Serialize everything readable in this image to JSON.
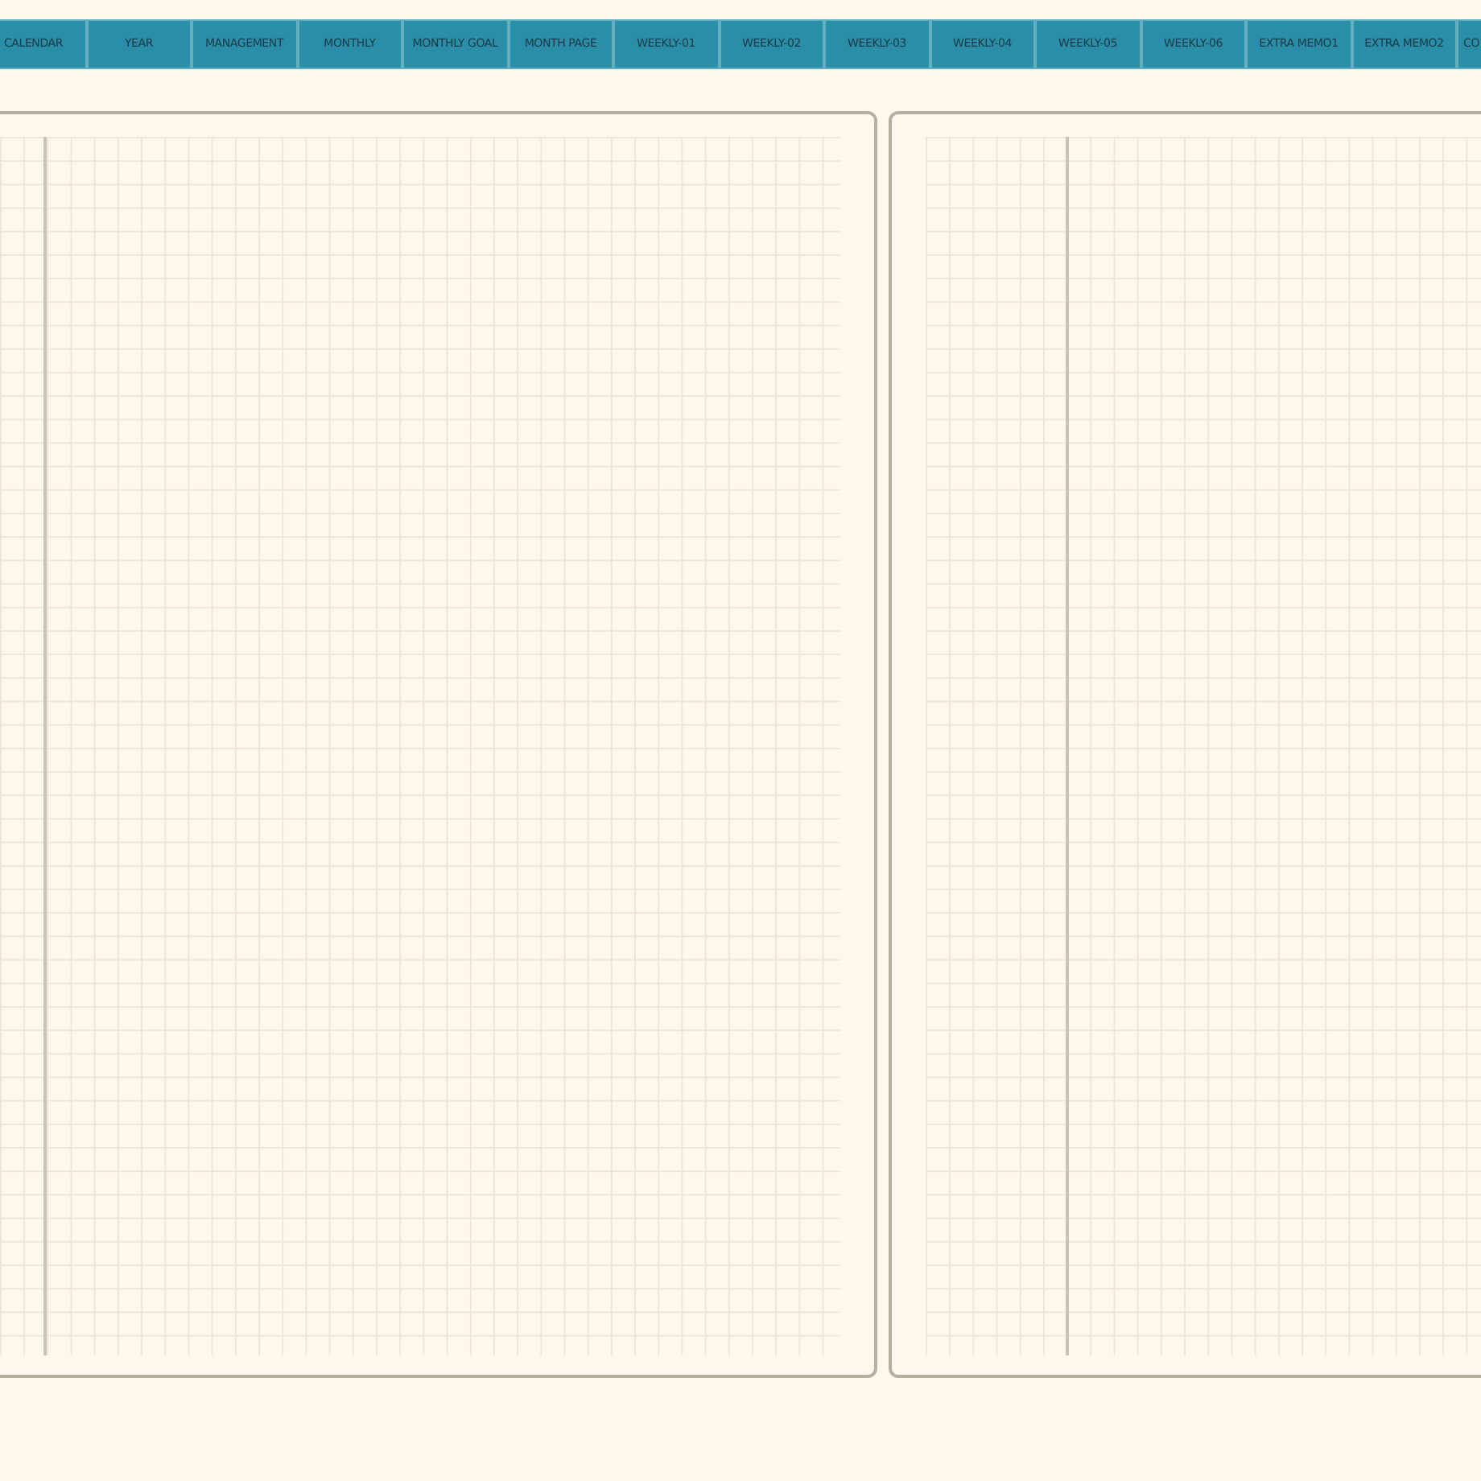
{
  "tabs": [
    {
      "label": "CALENDAR"
    },
    {
      "label": "YEAR"
    },
    {
      "label": "MANAGEMENT"
    },
    {
      "label": "MONTHLY"
    },
    {
      "label": "MONTHLY GOAL"
    },
    {
      "label": "MONTH PAGE"
    },
    {
      "label": "WEEKLY-01"
    },
    {
      "label": "WEEKLY-02"
    },
    {
      "label": "WEEKLY-03"
    },
    {
      "label": "WEEKLY-04"
    },
    {
      "label": "WEEKLY-05"
    },
    {
      "label": "WEEKLY-06"
    },
    {
      "label": "EXTRA MEMO1"
    },
    {
      "label": "EXTRA MEMO2"
    },
    {
      "label": "CO"
    }
  ]
}
